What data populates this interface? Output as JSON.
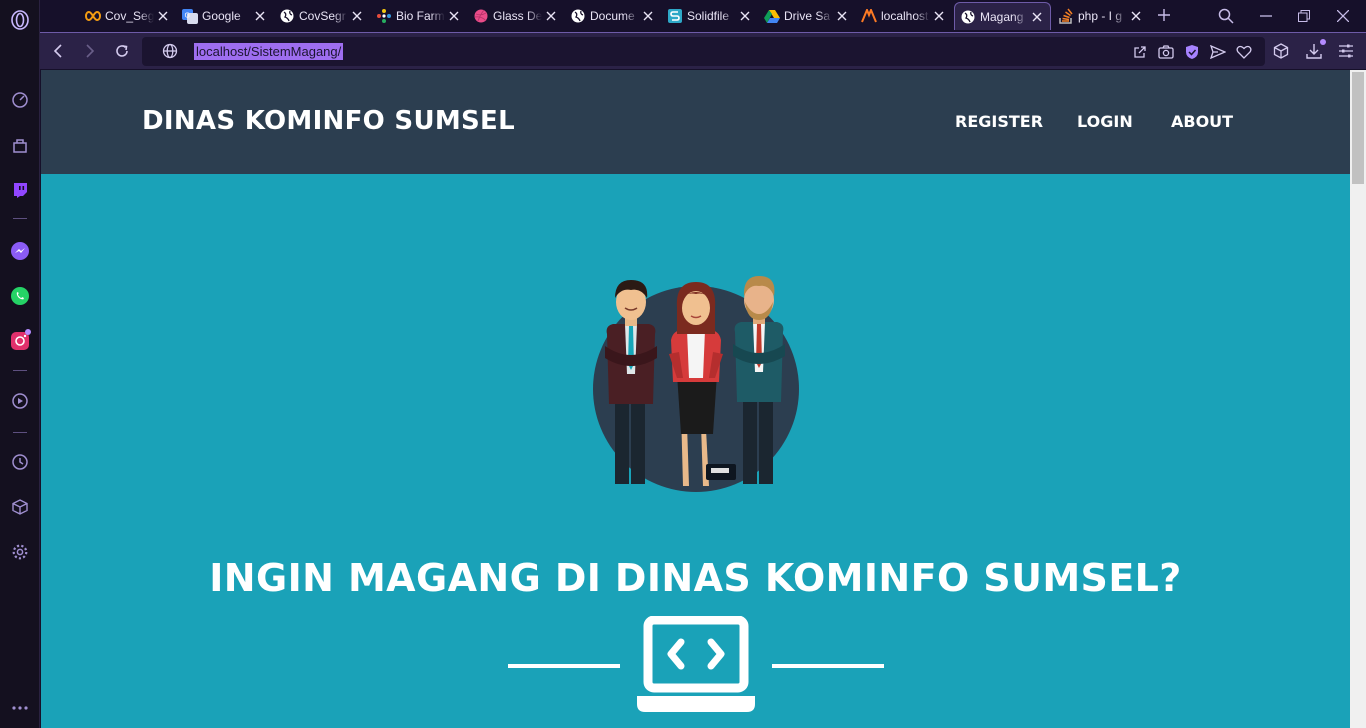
{
  "browser": {
    "tabs": [
      {
        "title": "Cov_Seg",
        "icon": "infinity-icon"
      },
      {
        "title": "Google",
        "icon": "google-translate-icon"
      },
      {
        "title": "CovSegr",
        "icon": "globe-icon"
      },
      {
        "title": "Bio Farm",
        "icon": "bio-farma-icon"
      },
      {
        "title": "Glass De",
        "icon": "dribbble-icon"
      },
      {
        "title": "Docume",
        "icon": "globe-icon"
      },
      {
        "title": "Solidfile",
        "icon": "solidfiles-icon"
      },
      {
        "title": "Drive Sa",
        "icon": "google-drive-icon"
      },
      {
        "title": "localhost",
        "icon": "xampp-icon"
      },
      {
        "title": "Magang",
        "icon": "globe-icon",
        "active": true
      },
      {
        "title": "php - I g",
        "icon": "stackoverflow-icon"
      }
    ],
    "url": "localhost/SistemMagang/",
    "accent": "#9e6ef0"
  },
  "site": {
    "brand": "DINAS KOMINFO SUMSEL",
    "nav": {
      "register": "REGISTER",
      "login": "LOGIN",
      "about": "ABOUT"
    },
    "hero_title": "INGIN MAGANG DI DINAS KOMINFO SUMSEL?",
    "colors": {
      "header_bg": "#2c3e50",
      "hero_bg": "#1aa2b8"
    }
  }
}
